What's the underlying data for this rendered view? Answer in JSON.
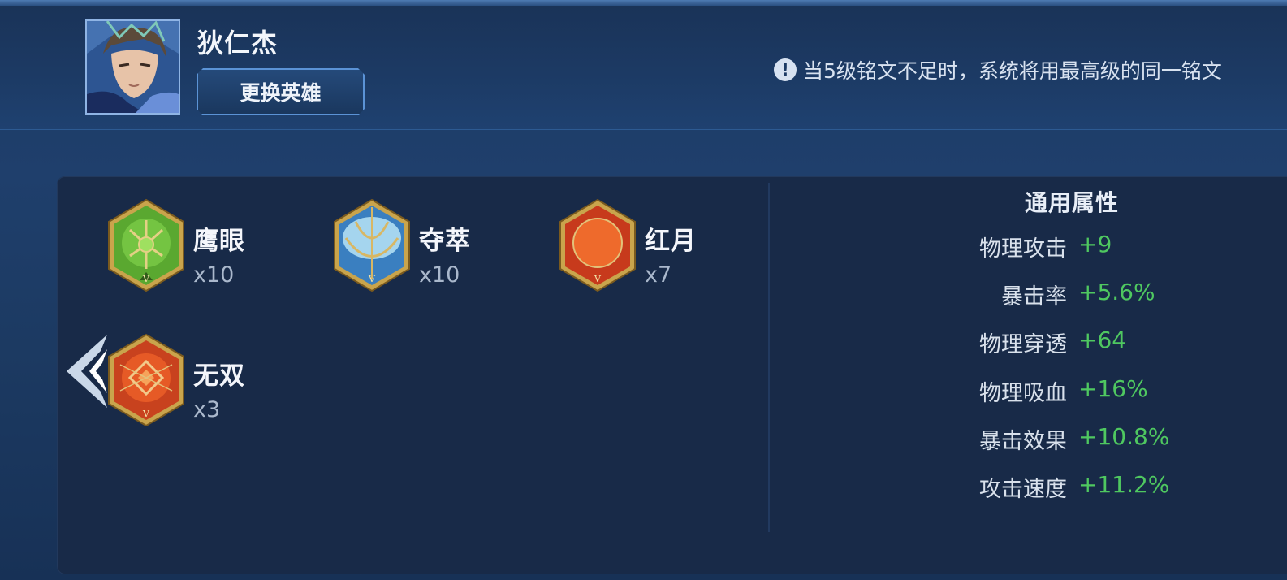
{
  "header": {
    "hero_name": "狄仁杰",
    "change_hero_label": "更换英雄",
    "notice_icon": "!",
    "notice_text": "当5级铭文不足时，系统将用最高级的同一铭文"
  },
  "runes": [
    {
      "name": "鹰眼",
      "count": "x10",
      "color": "#6cbf3a",
      "icon": "eagle-eye-rune-icon"
    },
    {
      "name": "夺萃",
      "count": "x10",
      "color": "#7fc4ea",
      "icon": "essence-rune-icon"
    },
    {
      "name": "红月",
      "count": "x7",
      "color": "#e2502a",
      "icon": "red-moon-rune-icon"
    },
    {
      "name": "无双",
      "count": "x3",
      "color": "#d9512b",
      "icon": "peerless-rune-icon"
    }
  ],
  "attributes": {
    "title": "通用属性",
    "items": [
      {
        "label": "物理攻击",
        "value": "+9"
      },
      {
        "label": "暴击率",
        "value": "+5.6%"
      },
      {
        "label": "物理穿透",
        "value": "+64"
      },
      {
        "label": "物理吸血",
        "value": "+16%"
      },
      {
        "label": "暴击效果",
        "value": "+10.8%"
      },
      {
        "label": "攻击速度",
        "value": "+11.2%"
      }
    ],
    "value_color": "#4fc860"
  }
}
